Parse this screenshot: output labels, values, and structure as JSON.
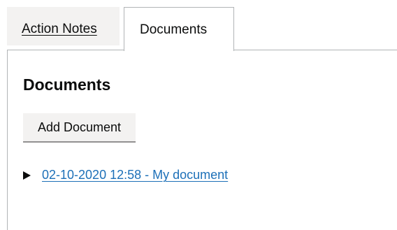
{
  "tabs": {
    "items": [
      {
        "label": "Action Notes",
        "active": false
      },
      {
        "label": "Documents",
        "active": true
      }
    ]
  },
  "panel": {
    "title": "Documents",
    "add_button_label": "Add Document",
    "documents": [
      {
        "label": "02-10-2020 12:58 - My document",
        "expanded": false
      }
    ]
  },
  "colors": {
    "link": "#1d70b8",
    "text": "#0b0c0c",
    "tab_inactive_bg": "#f3f2f1",
    "border": "#b1b4b6"
  }
}
